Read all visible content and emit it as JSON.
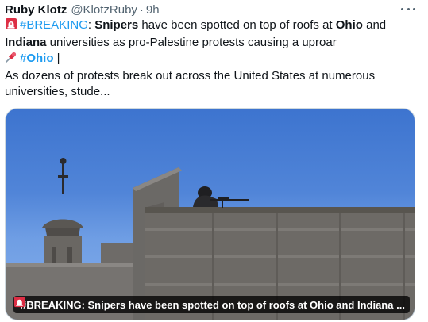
{
  "header": {
    "display_name": "Ruby Klotz",
    "handle": "@KlotzRuby",
    "separator": "·",
    "time": "9h"
  },
  "icons": {
    "more": "more-icon",
    "siren": "rotating-light-icon",
    "pushpin": "pushpin-icon"
  },
  "tweet": {
    "line1": {
      "hashtag": "#BREAKING",
      "t1": ": ",
      "b1": "Snipers",
      "t2": " have been spotted on top of roofs at ",
      "b2": "Ohio",
      "t3": " and"
    },
    "line2": {
      "b1": "Indiana",
      "t1": " universities as pro-Palestine protests causing a uproar"
    },
    "line3": {
      "hashtag": "#Ohio",
      "t1": " |"
    },
    "line4": "As dozens of protests break out across the United States at numerous",
    "line5": "universities, stude..."
  },
  "media": {
    "caption": "#BREAKING: Snipers have been spotted on top of roofs at Ohio and Indiana ..."
  },
  "colors": {
    "link": "#1d9bf0",
    "muted": "#536471",
    "text": "#0f1419",
    "sky": "#5185d8",
    "building": "#6d6a66"
  }
}
